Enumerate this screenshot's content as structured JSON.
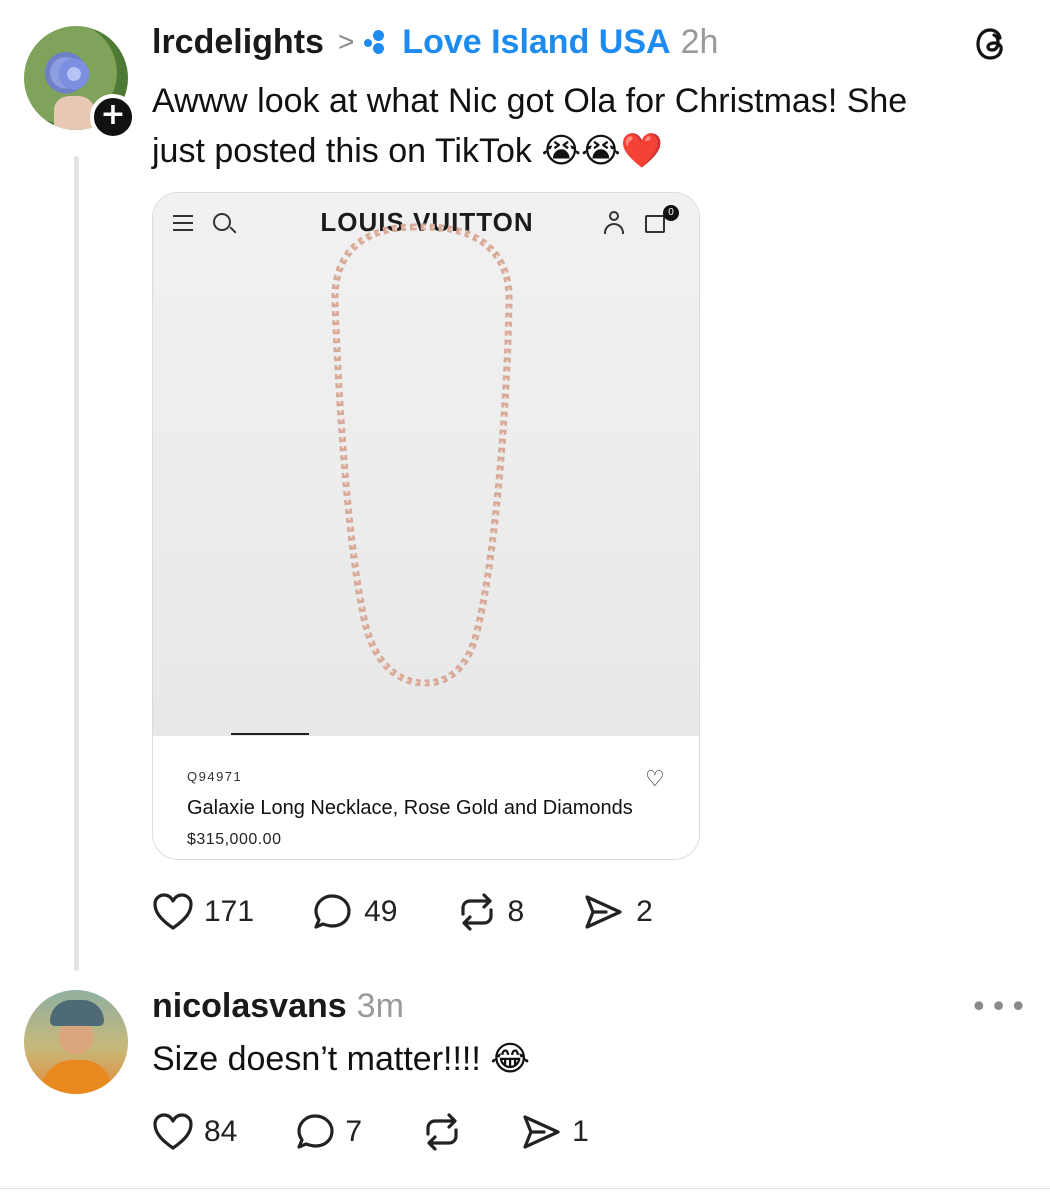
{
  "post": {
    "username": "lrcdelights",
    "breadcrumb_separator": ">",
    "community": "Love Island USA",
    "time": "2h",
    "text_line1": "Awww look at what Nic got Ola for Christmas! She",
    "text_line2": "just posted this on TikTok",
    "text_emojis": "😭😭❤️",
    "follow_symbol": "+",
    "threads_logo": "@",
    "card": {
      "brand": "LOUIS VUITTON",
      "bag_count": "0",
      "sku": "Q94971",
      "product_name": "Galaxie Long Necklace, Rose Gold and Diamonds",
      "price": "$315,000.00",
      "heart": "♡"
    },
    "actions": {
      "likes": "171",
      "comments": "49",
      "reposts": "8",
      "shares": "2"
    }
  },
  "reply": {
    "username": "nicolasvans",
    "time": "3m",
    "more": "•••",
    "text": "Size doesn’t matter!!!!",
    "emoji": "😂",
    "actions": {
      "likes": "84",
      "comments": "7",
      "reposts": "",
      "shares": "1"
    }
  },
  "icons": {
    "heart": "♡",
    "comment": "◯",
    "repost": "⟳",
    "share": "➢"
  },
  "colors": {
    "accent": "#1d8bf0",
    "muted": "#9a9a9a"
  }
}
